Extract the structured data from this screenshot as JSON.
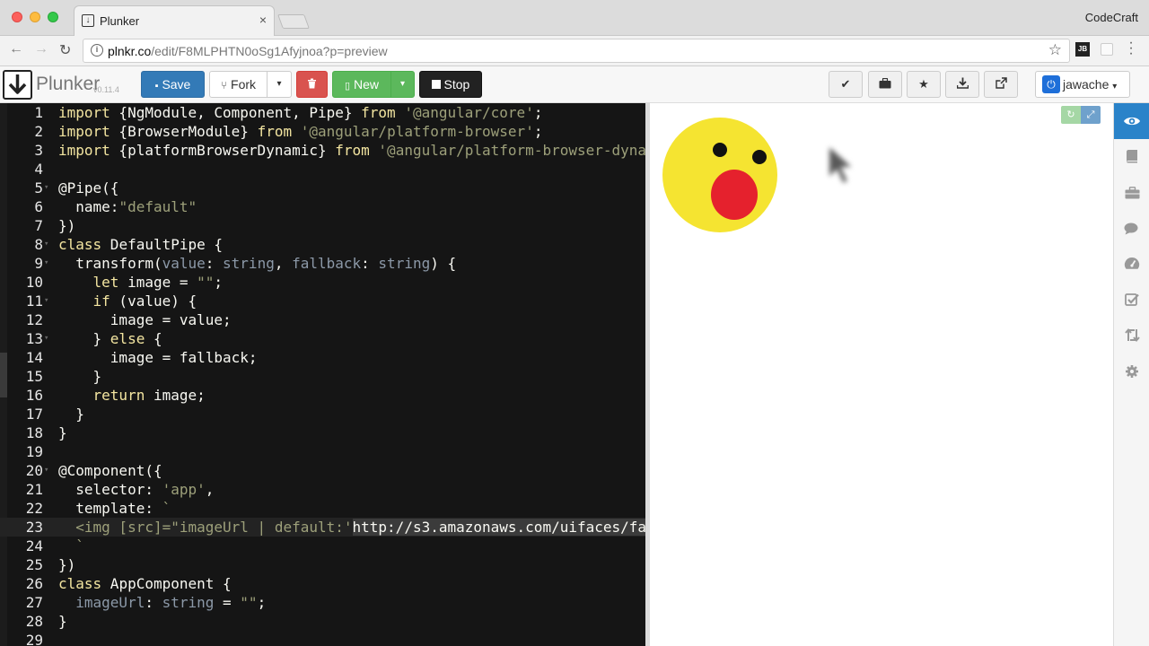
{
  "browser": {
    "tab_title": "Plunker",
    "tab_close": "×",
    "profile": "CodeCraft",
    "url_host": "plnkr.co",
    "url_path": "/edit/F8MLPHTN0oSg1Afyjnoa?p=preview",
    "ext_label": "JB",
    "nav": {
      "back": "←",
      "forward": "→",
      "reload": "↻",
      "info": "i",
      "star": "☆"
    }
  },
  "toolbar": {
    "logo_text": "Plunker",
    "version": "v0.11.4",
    "save_label": "Save",
    "fork_label": "Fork",
    "new_label": "New",
    "stop_label": "Stop",
    "caret": "▾",
    "save_icon": "floppy-icon",
    "delete_icon": "trash-icon",
    "user_name": "jawache",
    "icons": [
      "check-icon",
      "briefcase-icon",
      "star-icon",
      "download-icon",
      "external-link-icon"
    ]
  },
  "editor": {
    "active_line": 23,
    "lines": [
      {
        "n": "1",
        "tokens": [
          [
            "kw",
            "import"
          ],
          [
            "plain",
            " {NgModule, Component, Pipe} "
          ],
          [
            "kw",
            "from"
          ],
          [
            "plain",
            " "
          ],
          [
            "str",
            "'@angular/core'"
          ],
          [
            "plain",
            ";"
          ]
        ]
      },
      {
        "n": "2",
        "tokens": [
          [
            "kw",
            "import"
          ],
          [
            "plain",
            " {BrowserModule} "
          ],
          [
            "kw",
            "from"
          ],
          [
            "plain",
            " "
          ],
          [
            "str",
            "'@angular/platform-browser'"
          ],
          [
            "plain",
            ";"
          ]
        ]
      },
      {
        "n": "3",
        "tokens": [
          [
            "kw",
            "import"
          ],
          [
            "plain",
            " {platformBrowserDynamic} "
          ],
          [
            "kw",
            "from"
          ],
          [
            "plain",
            " "
          ],
          [
            "str",
            "'@angular/platform-browser-dyna"
          ]
        ]
      },
      {
        "n": "4",
        "tokens": []
      },
      {
        "n": "5",
        "tokens": [
          [
            "plain",
            "@Pipe({"
          ]
        ]
      },
      {
        "n": "6",
        "tokens": [
          [
            "plain",
            "  name:"
          ],
          [
            "str",
            "\"default\""
          ]
        ]
      },
      {
        "n": "7",
        "tokens": [
          [
            "plain",
            "})"
          ]
        ]
      },
      {
        "n": "8",
        "tokens": [
          [
            "kw",
            "class"
          ],
          [
            "plain",
            " DefaultPipe {"
          ]
        ]
      },
      {
        "n": "9",
        "tokens": [
          [
            "plain",
            "  transform("
          ],
          [
            "prop",
            "value"
          ],
          [
            "plain",
            ": "
          ],
          [
            "type",
            "string"
          ],
          [
            "plain",
            ", "
          ],
          [
            "prop",
            "fallback"
          ],
          [
            "plain",
            ": "
          ],
          [
            "type",
            "string"
          ],
          [
            "plain",
            ") {"
          ]
        ]
      },
      {
        "n": "10",
        "tokens": [
          [
            "plain",
            "    "
          ],
          [
            "kw",
            "let"
          ],
          [
            "plain",
            " image = "
          ],
          [
            "str",
            "\"\""
          ],
          [
            "plain",
            ";"
          ]
        ]
      },
      {
        "n": "11",
        "tokens": [
          [
            "plain",
            "    "
          ],
          [
            "kw",
            "if"
          ],
          [
            "plain",
            " (value) {"
          ]
        ]
      },
      {
        "n": "12",
        "tokens": [
          [
            "plain",
            "      image = value;"
          ]
        ]
      },
      {
        "n": "13",
        "tokens": [
          [
            "plain",
            "    } "
          ],
          [
            "kw",
            "else"
          ],
          [
            "plain",
            " {"
          ]
        ]
      },
      {
        "n": "14",
        "tokens": [
          [
            "plain",
            "      image = fallback;"
          ]
        ]
      },
      {
        "n": "15",
        "tokens": [
          [
            "plain",
            "    }"
          ]
        ]
      },
      {
        "n": "16",
        "tokens": [
          [
            "plain",
            "    "
          ],
          [
            "kw",
            "return"
          ],
          [
            "plain",
            " image;"
          ]
        ]
      },
      {
        "n": "17",
        "tokens": [
          [
            "plain",
            "  }"
          ]
        ]
      },
      {
        "n": "18",
        "tokens": [
          [
            "plain",
            "}"
          ]
        ]
      },
      {
        "n": "19",
        "tokens": []
      },
      {
        "n": "20",
        "tokens": [
          [
            "plain",
            "@Component({"
          ]
        ]
      },
      {
        "n": "21",
        "tokens": [
          [
            "plain",
            "  selector: "
          ],
          [
            "str",
            "'app'"
          ],
          [
            "plain",
            ","
          ]
        ]
      },
      {
        "n": "22",
        "tokens": [
          [
            "plain",
            "  template: "
          ],
          [
            "str",
            "`"
          ]
        ]
      },
      {
        "n": "23",
        "tokens": [
          [
            "str",
            "  <img [src]=\"imageUrl | default:'"
          ],
          [
            "sel",
            "http://s3.amazonaws.com/uifaces/fa"
          ]
        ]
      },
      {
        "n": "24",
        "tokens": [
          [
            "str",
            "  `"
          ]
        ]
      },
      {
        "n": "25",
        "tokens": [
          [
            "plain",
            "})"
          ]
        ]
      },
      {
        "n": "26",
        "tokens": [
          [
            "kw",
            "class"
          ],
          [
            "plain",
            " AppComponent {"
          ]
        ]
      },
      {
        "n": "27",
        "tokens": [
          [
            "plain",
            "  "
          ],
          [
            "prop",
            "imageUrl"
          ],
          [
            "plain",
            ": "
          ],
          [
            "type",
            "string"
          ],
          [
            "plain",
            " = "
          ],
          [
            "str",
            "\"\""
          ],
          [
            "plain",
            ";"
          ]
        ]
      },
      {
        "n": "28",
        "tokens": [
          [
            "plain",
            "}"
          ]
        ]
      },
      {
        "n": "29",
        "tokens": []
      }
    ],
    "fold_lines": [
      "5",
      "8",
      "9",
      "11",
      "13",
      "20"
    ]
  },
  "preview": {
    "refresh_icon": "refresh-icon",
    "expand_icon": "expand-icon"
  },
  "sidebar": {
    "items": [
      "eye-icon",
      "book-icon",
      "briefcase-icon",
      "comments-icon",
      "dashboard-icon",
      "checklist-icon",
      "retweet-icon",
      "gear-icon"
    ],
    "active": "eye-icon"
  },
  "colors": {
    "save": "#337ab7",
    "delete": "#d9534f",
    "new": "#5cb85c",
    "stop": "#222222",
    "editor_bg": "#151515",
    "face": "#f5e431",
    "mouth": "#e5212d",
    "sidebar_active": "#2a83c9"
  }
}
